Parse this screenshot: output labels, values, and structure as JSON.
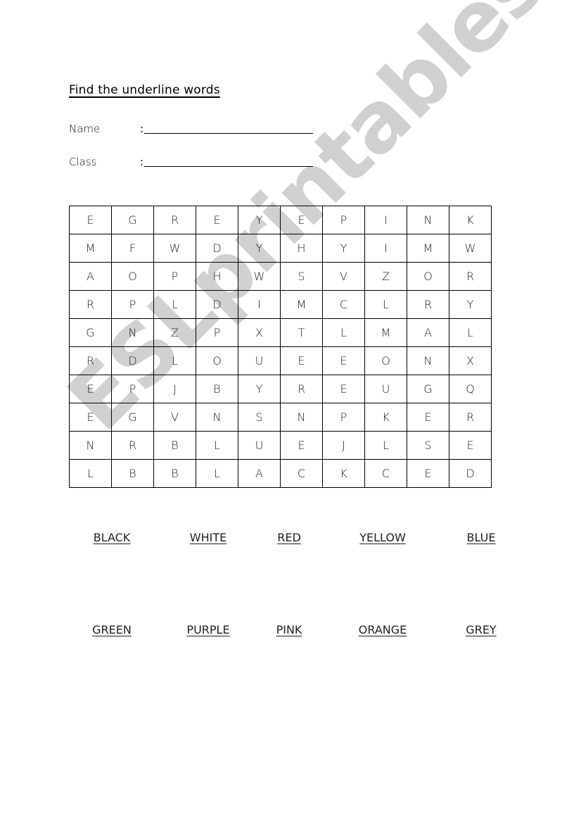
{
  "title": "Find the underline words",
  "fields": [
    {
      "label": "Name",
      "colon": ":"
    },
    {
      "label": "Class",
      "colon": ":"
    }
  ],
  "grid": [
    [
      "E",
      "G",
      "R",
      "E",
      "Y",
      "E",
      "P",
      "I",
      "N",
      "K"
    ],
    [
      "M",
      "F",
      "W",
      "D",
      "Y",
      "H",
      "Y",
      "I",
      "M",
      "W"
    ],
    [
      "A",
      "O",
      "P",
      "H",
      "W",
      "S",
      "V",
      "Z",
      "O",
      "R"
    ],
    [
      "R",
      "P",
      "L",
      "D",
      "I",
      "M",
      "C",
      "L",
      "R",
      "Y"
    ],
    [
      "G",
      "N",
      "Z",
      "P",
      "X",
      "T",
      "L",
      "M",
      "A",
      "L"
    ],
    [
      "R",
      "D",
      "L",
      "O",
      "U",
      "E",
      "E",
      "O",
      "N",
      "X"
    ],
    [
      "E",
      "P",
      "J",
      "B",
      "Y",
      "R",
      "E",
      "U",
      "G",
      "Q"
    ],
    [
      "E",
      "G",
      "V",
      "N",
      "S",
      "N",
      "P",
      "K",
      "E",
      "R"
    ],
    [
      "N",
      "R",
      "B",
      "L",
      "U",
      "E",
      "J",
      "L",
      "S",
      "E"
    ],
    [
      "L",
      "B",
      "B",
      "L",
      "A",
      "C",
      "K",
      "C",
      "E",
      "D"
    ]
  ],
  "words_row1": [
    "BLACK",
    "WHITE",
    "RED",
    "YELLOW",
    "BLUE"
  ],
  "words_row2": [
    "GREEN",
    "PURPLE",
    "PINK",
    "ORANGE",
    "GREY"
  ],
  "watermark": "ESLprintables.com",
  "colors": {
    "watermark": "#c8c8c8",
    "text": "#000000",
    "background": "#ffffff"
  }
}
